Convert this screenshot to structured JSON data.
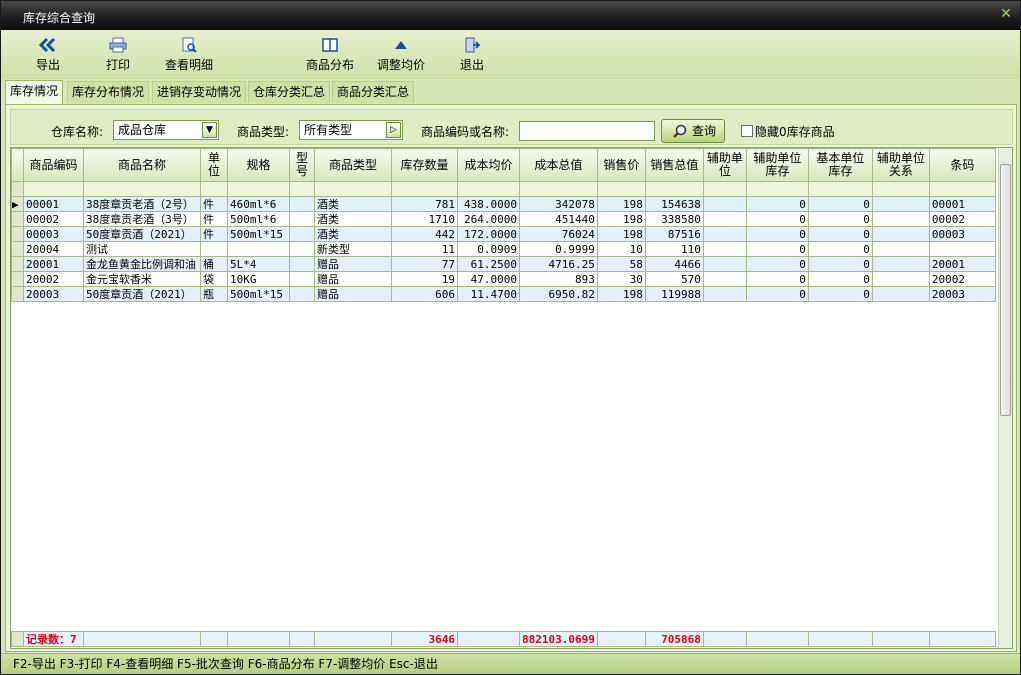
{
  "window": {
    "title": "库存综合查询",
    "close_glyph": "✕"
  },
  "toolbar": {
    "export": {
      "label": "导出",
      "icon": "double-chevron-left-icon"
    },
    "print": {
      "label": "打印",
      "icon": "printer-icon"
    },
    "detail": {
      "label": "查看明细",
      "icon": "document-magnifier-icon"
    },
    "distribution": {
      "label": "商品分布",
      "icon": "book-icon"
    },
    "adjust": {
      "label": "调整均价",
      "icon": "triangle-up-icon"
    },
    "exit": {
      "label": "退出",
      "icon": "exit-door-icon"
    }
  },
  "tabs": [
    "库存情况",
    "库存分布情况",
    "进销存变动情况",
    "仓库分类汇总",
    "商品分类汇总"
  ],
  "filters": {
    "warehouse_label": "仓库名称:",
    "warehouse_value": "成品仓库",
    "type_label": "商品类型:",
    "type_value": "所有类型",
    "code_label": "商品编码或名称:",
    "code_value": "",
    "query_label": "查询",
    "hide_zero_label": "隐藏0库存商品"
  },
  "table": {
    "columns": [
      "商品编码",
      "商品名称",
      "单位",
      "规格",
      "型号",
      "商品类型",
      "库存数量",
      "成本均价",
      "成本总值",
      "销售价",
      "销售总值",
      "辅助单位",
      "辅助单位库存",
      "基本单位库存",
      "辅助单位关系",
      "条码"
    ],
    "rows": [
      [
        "00001",
        "38度章贡老酒（2号）",
        "件",
        "460ml*6",
        "",
        "酒类",
        "781",
        "438.0000",
        "342078",
        "198",
        "154638",
        "",
        "0",
        "0",
        "",
        "00001"
      ],
      [
        "00002",
        "38度章贡老酒（3号）",
        "件",
        "500ml*6",
        "",
        "酒类",
        "1710",
        "264.0000",
        "451440",
        "198",
        "338580",
        "",
        "0",
        "0",
        "",
        "00002"
      ],
      [
        "00003",
        "50度章贡酒（2021）",
        "件",
        "500ml*15",
        "",
        "酒类",
        "442",
        "172.0000",
        "76024",
        "198",
        "87516",
        "",
        "0",
        "0",
        "",
        "00003"
      ],
      [
        "20004",
        "测试",
        "",
        "",
        "",
        "新类型",
        "11",
        "0.0909",
        "0.9999",
        "10",
        "110",
        "",
        "0",
        "0",
        "",
        ""
      ],
      [
        "20001",
        "金龙鱼黄金比例调和油",
        "桶",
        "5L*4",
        "",
        "赠品",
        "77",
        "61.2500",
        "4716.25",
        "58",
        "4466",
        "",
        "0",
        "0",
        "",
        "20001"
      ],
      [
        "20002",
        "金元宝软香米",
        "袋",
        "10KG",
        "",
        "赠品",
        "19",
        "47.0000",
        "893",
        "30",
        "570",
        "",
        "0",
        "0",
        "",
        "20002"
      ],
      [
        "20003",
        "50度章贡酒（2021）",
        "瓶",
        "500ml*15",
        "",
        "赠品",
        "606",
        "11.4700",
        "6950.82",
        "198",
        "119988",
        "",
        "0",
        "0",
        "",
        "20003"
      ]
    ],
    "total": {
      "label": "记录数：7",
      "qty": "3646",
      "cost_total": "882103.0699",
      "sales_total": "705868"
    }
  },
  "statusbar": "F2-导出 F3-打印 F4-查看明细 F5-批次查询 F6-商品分布 F7-调整均价 Esc-退出",
  "colors": {
    "accent": "#d6e6b4",
    "total_text": "#e0001a",
    "title_bg": "#1c1c1c"
  }
}
